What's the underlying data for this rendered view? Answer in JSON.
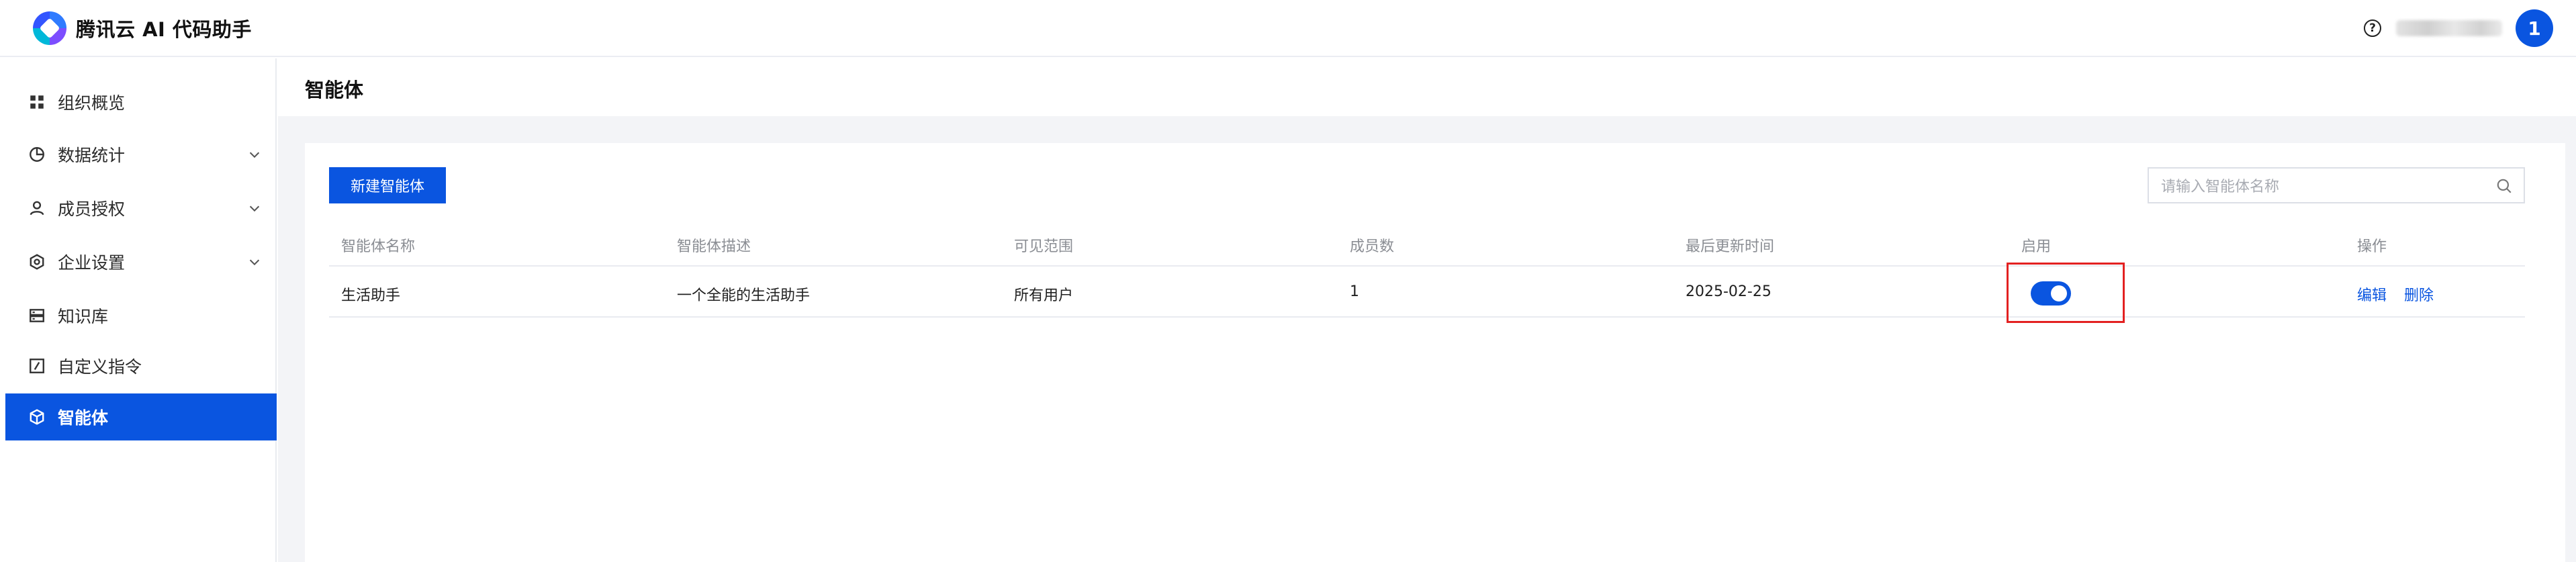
{
  "header": {
    "brand": "腾讯云 AI 代码助手",
    "help_icon": "question-circle-icon",
    "avatar_text": "1"
  },
  "sidebar": {
    "items": [
      {
        "label": "组织概览",
        "icon": "grid-icon",
        "expandable": false,
        "active": false
      },
      {
        "label": "数据统计",
        "icon": "pie-chart-icon",
        "expandable": true,
        "active": false
      },
      {
        "label": "成员授权",
        "icon": "user-icon",
        "expandable": true,
        "active": false
      },
      {
        "label": "企业设置",
        "icon": "settings-icon",
        "expandable": true,
        "active": false
      },
      {
        "label": "知识库",
        "icon": "database-icon",
        "expandable": false,
        "active": false
      },
      {
        "label": "自定义指令",
        "icon": "edit-box-icon",
        "expandable": false,
        "active": false
      },
      {
        "label": "智能体",
        "icon": "cube-icon",
        "expandable": false,
        "active": true
      }
    ]
  },
  "main": {
    "title": "智能体",
    "new_button": "新建智能体",
    "search_placeholder": "请输入智能体名称",
    "table": {
      "headers": [
        "智能体名称",
        "智能体描述",
        "可见范围",
        "成员数",
        "最后更新时间",
        "启用",
        "操作"
      ],
      "rows": [
        {
          "name": "生活助手",
          "description": "一个全能的生活助手",
          "visibility": "所有用户",
          "members": "1",
          "updated": "2025-02-25",
          "enabled": true,
          "actions": {
            "edit": "编辑",
            "delete": "删除"
          }
        }
      ]
    }
  },
  "colors": {
    "primary": "#0a55e0",
    "highlight_box": "#e32121",
    "page_bg": "#f3f4f7"
  }
}
